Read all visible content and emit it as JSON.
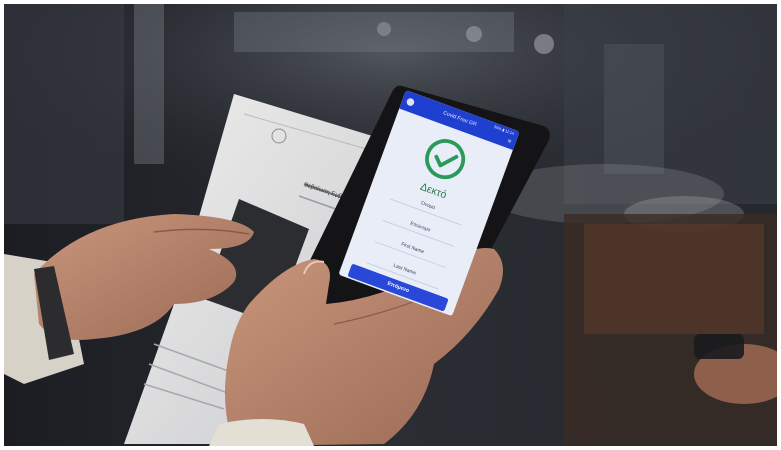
{
  "app": {
    "title": "Covid Free GR",
    "status_time": "56% ▮ 11:14",
    "verdict": "Δεκτό",
    "fields": [
      "Όνομα",
      "Επώνυμο",
      "First Name",
      "Last Name"
    ],
    "button_label": "Επόμενο"
  },
  "document": {
    "heading": "Βεβαίωση Εμβ"
  },
  "colors": {
    "app_bar": "#1e3fd0",
    "accept_green": "#2a9a5a",
    "screen_bg": "#e8edf8"
  }
}
